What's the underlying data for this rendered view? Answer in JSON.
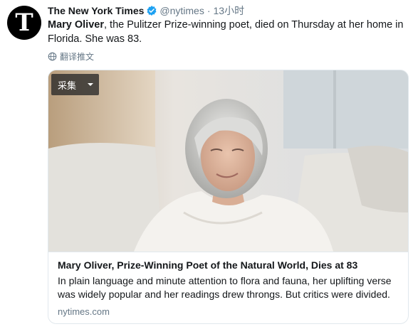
{
  "author": {
    "avatar_letter": "T",
    "name": "The New York Times",
    "handle": "@nytimes",
    "separator": "·",
    "time": "13小时",
    "verified_color": "#1da1f2"
  },
  "tweet": {
    "text_bold": "Mary Oliver",
    "text_rest": ", the Pulitzer Prize-winning poet, died on Thursday at her home in Florida. She was 83.",
    "translate_label": "翻译推文"
  },
  "card": {
    "collect_label": "采集",
    "title": "Mary Oliver, Prize-Winning Poet of the Natural World, Dies at 83",
    "description": "In plain language and minute attention to flora and fauna, her uplifting verse was widely popular and her readings drew throngs. But critics were divided.",
    "domain": "nytimes.com"
  }
}
